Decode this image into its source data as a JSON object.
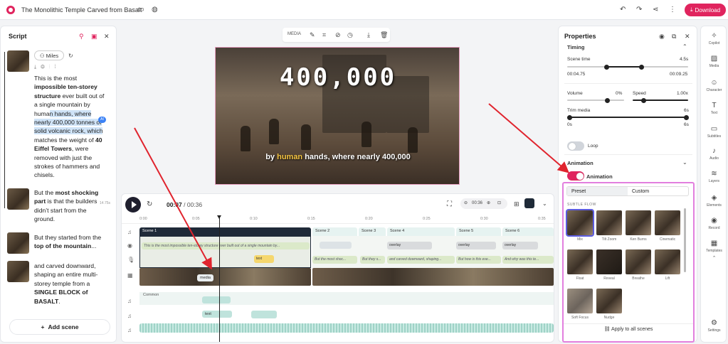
{
  "app": {
    "project_title": "The Monolithic Temple Carved from Basalt",
    "download_label": "Download"
  },
  "script": {
    "panel_title": "Script",
    "actor": "Miles",
    "scene1_text_parts": [
      "This is the most ",
      "impossible ten-storey structure",
      " ever built out of a single mountain by huma",
      "n hands, where nearly 400,000 tonnes o",
      "f solid volcanic rock, which",
      " matches the weight of ",
      "40 Eiffel Towers",
      ", were removed with just the strokes of hammers and chisels."
    ],
    "scene1_duration": "14.75s",
    "scene2_parts": [
      "But the ",
      "most shocking part",
      " is that the builders didn’t start from the ground."
    ],
    "scene3_parts": [
      "But they started from the ",
      "top of the mountain",
      "..."
    ],
    "scene4_parts": [
      "and carved downward, shaping an entire multi-storey temple from a ",
      "SINGLE BLOCK of BASALT",
      "."
    ],
    "add_scene_label": "Add scene"
  },
  "canvas": {
    "toolbar_label": "MEDIA",
    "big_text": "400,000",
    "caption_pre": "by ",
    "caption_acc": "human",
    "caption_post": " hands, where nearly 400,000"
  },
  "timeline": {
    "current": "00:07",
    "total": "00:36",
    "zoom_readout": "00:36",
    "ticks": [
      "0:00",
      "0:05",
      "0:10",
      "0:15",
      "0:20",
      "0:25",
      "0:30",
      "0:35"
    ],
    "scenes": [
      "Scene 1",
      "Scene 2",
      "Scene 3",
      "Scene 4",
      "Scene 5",
      "Scene 6"
    ],
    "caption_track": [
      "This is the most impossible ten-storey structure ever built out of a single mountain by...",
      "But the most shoc...",
      "But they s...",
      "and carved downward, shaping...",
      "But how is this eve...",
      "And why was this te..."
    ],
    "overlay_label": "overlay",
    "text_label": "text",
    "media_label": "media",
    "common_label": "Common"
  },
  "properties": {
    "title": "Properties",
    "timing_label": "Timing",
    "scene_time_label": "Scene time",
    "scene_time_value": "4.5s",
    "range_start": "00:04.75",
    "range_end": "00:09.25",
    "volume_label": "Volume",
    "volume_value": "0%",
    "speed_label": "Speed",
    "speed_value": "1.00x",
    "trim_label": "Trim media",
    "trim_max": "6s",
    "trim_start": "0s",
    "trim_end": "6s",
    "loop_label": "Loop",
    "animation_section": "Animation",
    "animation_toggle_label": "Animation",
    "tab_preset": "Preset",
    "tab_custom": "Custom",
    "group_label": "SUBTLE FLOW",
    "presets": [
      "Mix",
      "Tilt Zoom",
      "Ken Burns",
      "Cinematic",
      "Float",
      "Reveal",
      "Breathe",
      "Lift",
      "Soft Focus",
      "Nudge"
    ],
    "apply_label": "Apply to all scenes"
  },
  "rail": [
    "Copilot",
    "Media",
    "Character",
    "Text",
    "Subtitles",
    "Audio",
    "Layers",
    "Elements",
    "Record",
    "Templates",
    "Settings"
  ],
  "colors": {
    "accent": "#e0245e",
    "selection": "#e27fde",
    "arrow": "#e0242e"
  }
}
